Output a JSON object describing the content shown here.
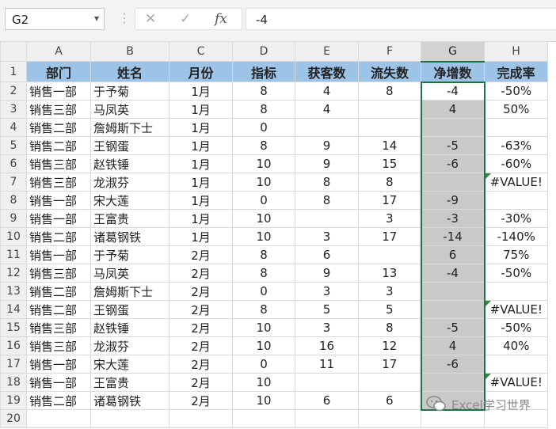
{
  "formula_bar": {
    "name_box": "G2",
    "cancel_icon": "✕",
    "enter_icon": "✓",
    "fx_label": "fx",
    "formula": "-4"
  },
  "columns": [
    "A",
    "B",
    "C",
    "D",
    "E",
    "F",
    "G",
    "H"
  ],
  "selected_column": "G",
  "header_row": {
    "num": "1",
    "cells": [
      "部门",
      "姓名",
      "月份",
      "指标",
      "获客数",
      "流失数",
      "净增数",
      "完成率"
    ]
  },
  "rows": [
    {
      "num": "2",
      "cells": [
        "销售一部",
        "于予菊",
        "1月",
        "8",
        "4",
        "8",
        "-4",
        "-50%"
      ]
    },
    {
      "num": "3",
      "cells": [
        "销售三部",
        "马凤英",
        "1月",
        "8",
        "4",
        "",
        "4",
        "50%"
      ]
    },
    {
      "num": "4",
      "cells": [
        "销售二部",
        "詹姆斯下士",
        "1月",
        "0",
        "",
        "",
        "",
        ""
      ]
    },
    {
      "num": "5",
      "cells": [
        "销售二部",
        "王钢蛋",
        "1月",
        "8",
        "9",
        "14",
        "-5",
        "-63%"
      ]
    },
    {
      "num": "6",
      "cells": [
        "销售三部",
        "赵铁锤",
        "1月",
        "10",
        "9",
        "15",
        "-6",
        "-60%"
      ]
    },
    {
      "num": "7",
      "cells": [
        "销售三部",
        "龙淑芬",
        "1月",
        "10",
        "8",
        "8",
        "",
        "#VALUE!"
      ]
    },
    {
      "num": "8",
      "cells": [
        "销售一部",
        "宋大莲",
        "1月",
        "0",
        "8",
        "17",
        "-9",
        ""
      ]
    },
    {
      "num": "9",
      "cells": [
        "销售一部",
        "王富贵",
        "1月",
        "10",
        "",
        "3",
        "-3",
        "-30%"
      ]
    },
    {
      "num": "10",
      "cells": [
        "销售二部",
        "诸葛钢铁",
        "1月",
        "10",
        "3",
        "17",
        "-14",
        "-140%"
      ]
    },
    {
      "num": "11",
      "cells": [
        "销售一部",
        "于予菊",
        "2月",
        "8",
        "6",
        "",
        "6",
        "75%"
      ]
    },
    {
      "num": "12",
      "cells": [
        "销售三部",
        "马凤英",
        "2月",
        "8",
        "9",
        "13",
        "-4",
        "-50%"
      ]
    },
    {
      "num": "13",
      "cells": [
        "销售二部",
        "詹姆斯下士",
        "2月",
        "0",
        "3",
        "3",
        "",
        ""
      ]
    },
    {
      "num": "14",
      "cells": [
        "销售二部",
        "王钢蛋",
        "2月",
        "8",
        "5",
        "5",
        "",
        "#VALUE!"
      ]
    },
    {
      "num": "15",
      "cells": [
        "销售三部",
        "赵铁锤",
        "2月",
        "10",
        "3",
        "8",
        "-5",
        "-50%"
      ]
    },
    {
      "num": "16",
      "cells": [
        "销售三部",
        "龙淑芬",
        "2月",
        "10",
        "16",
        "12",
        "4",
        "40%"
      ]
    },
    {
      "num": "17",
      "cells": [
        "销售一部",
        "宋大莲",
        "2月",
        "0",
        "11",
        "17",
        "-6",
        ""
      ]
    },
    {
      "num": "18",
      "cells": [
        "销售一部",
        "王富贵",
        "2月",
        "10",
        "",
        "",
        "",
        "#VALUE!"
      ]
    },
    {
      "num": "19",
      "cells": [
        "销售二部",
        "诸葛钢铁",
        "2月",
        "10",
        "6",
        "6",
        "",
        ""
      ]
    }
  ],
  "partial_row_num": "20",
  "watermark": "Excel学习世界",
  "colors": {
    "header_fill": "#9dc3e6",
    "selection_fill": "#c9c9c9",
    "selection_border": "#217346",
    "error_triangle": "#2e8b3a"
  }
}
